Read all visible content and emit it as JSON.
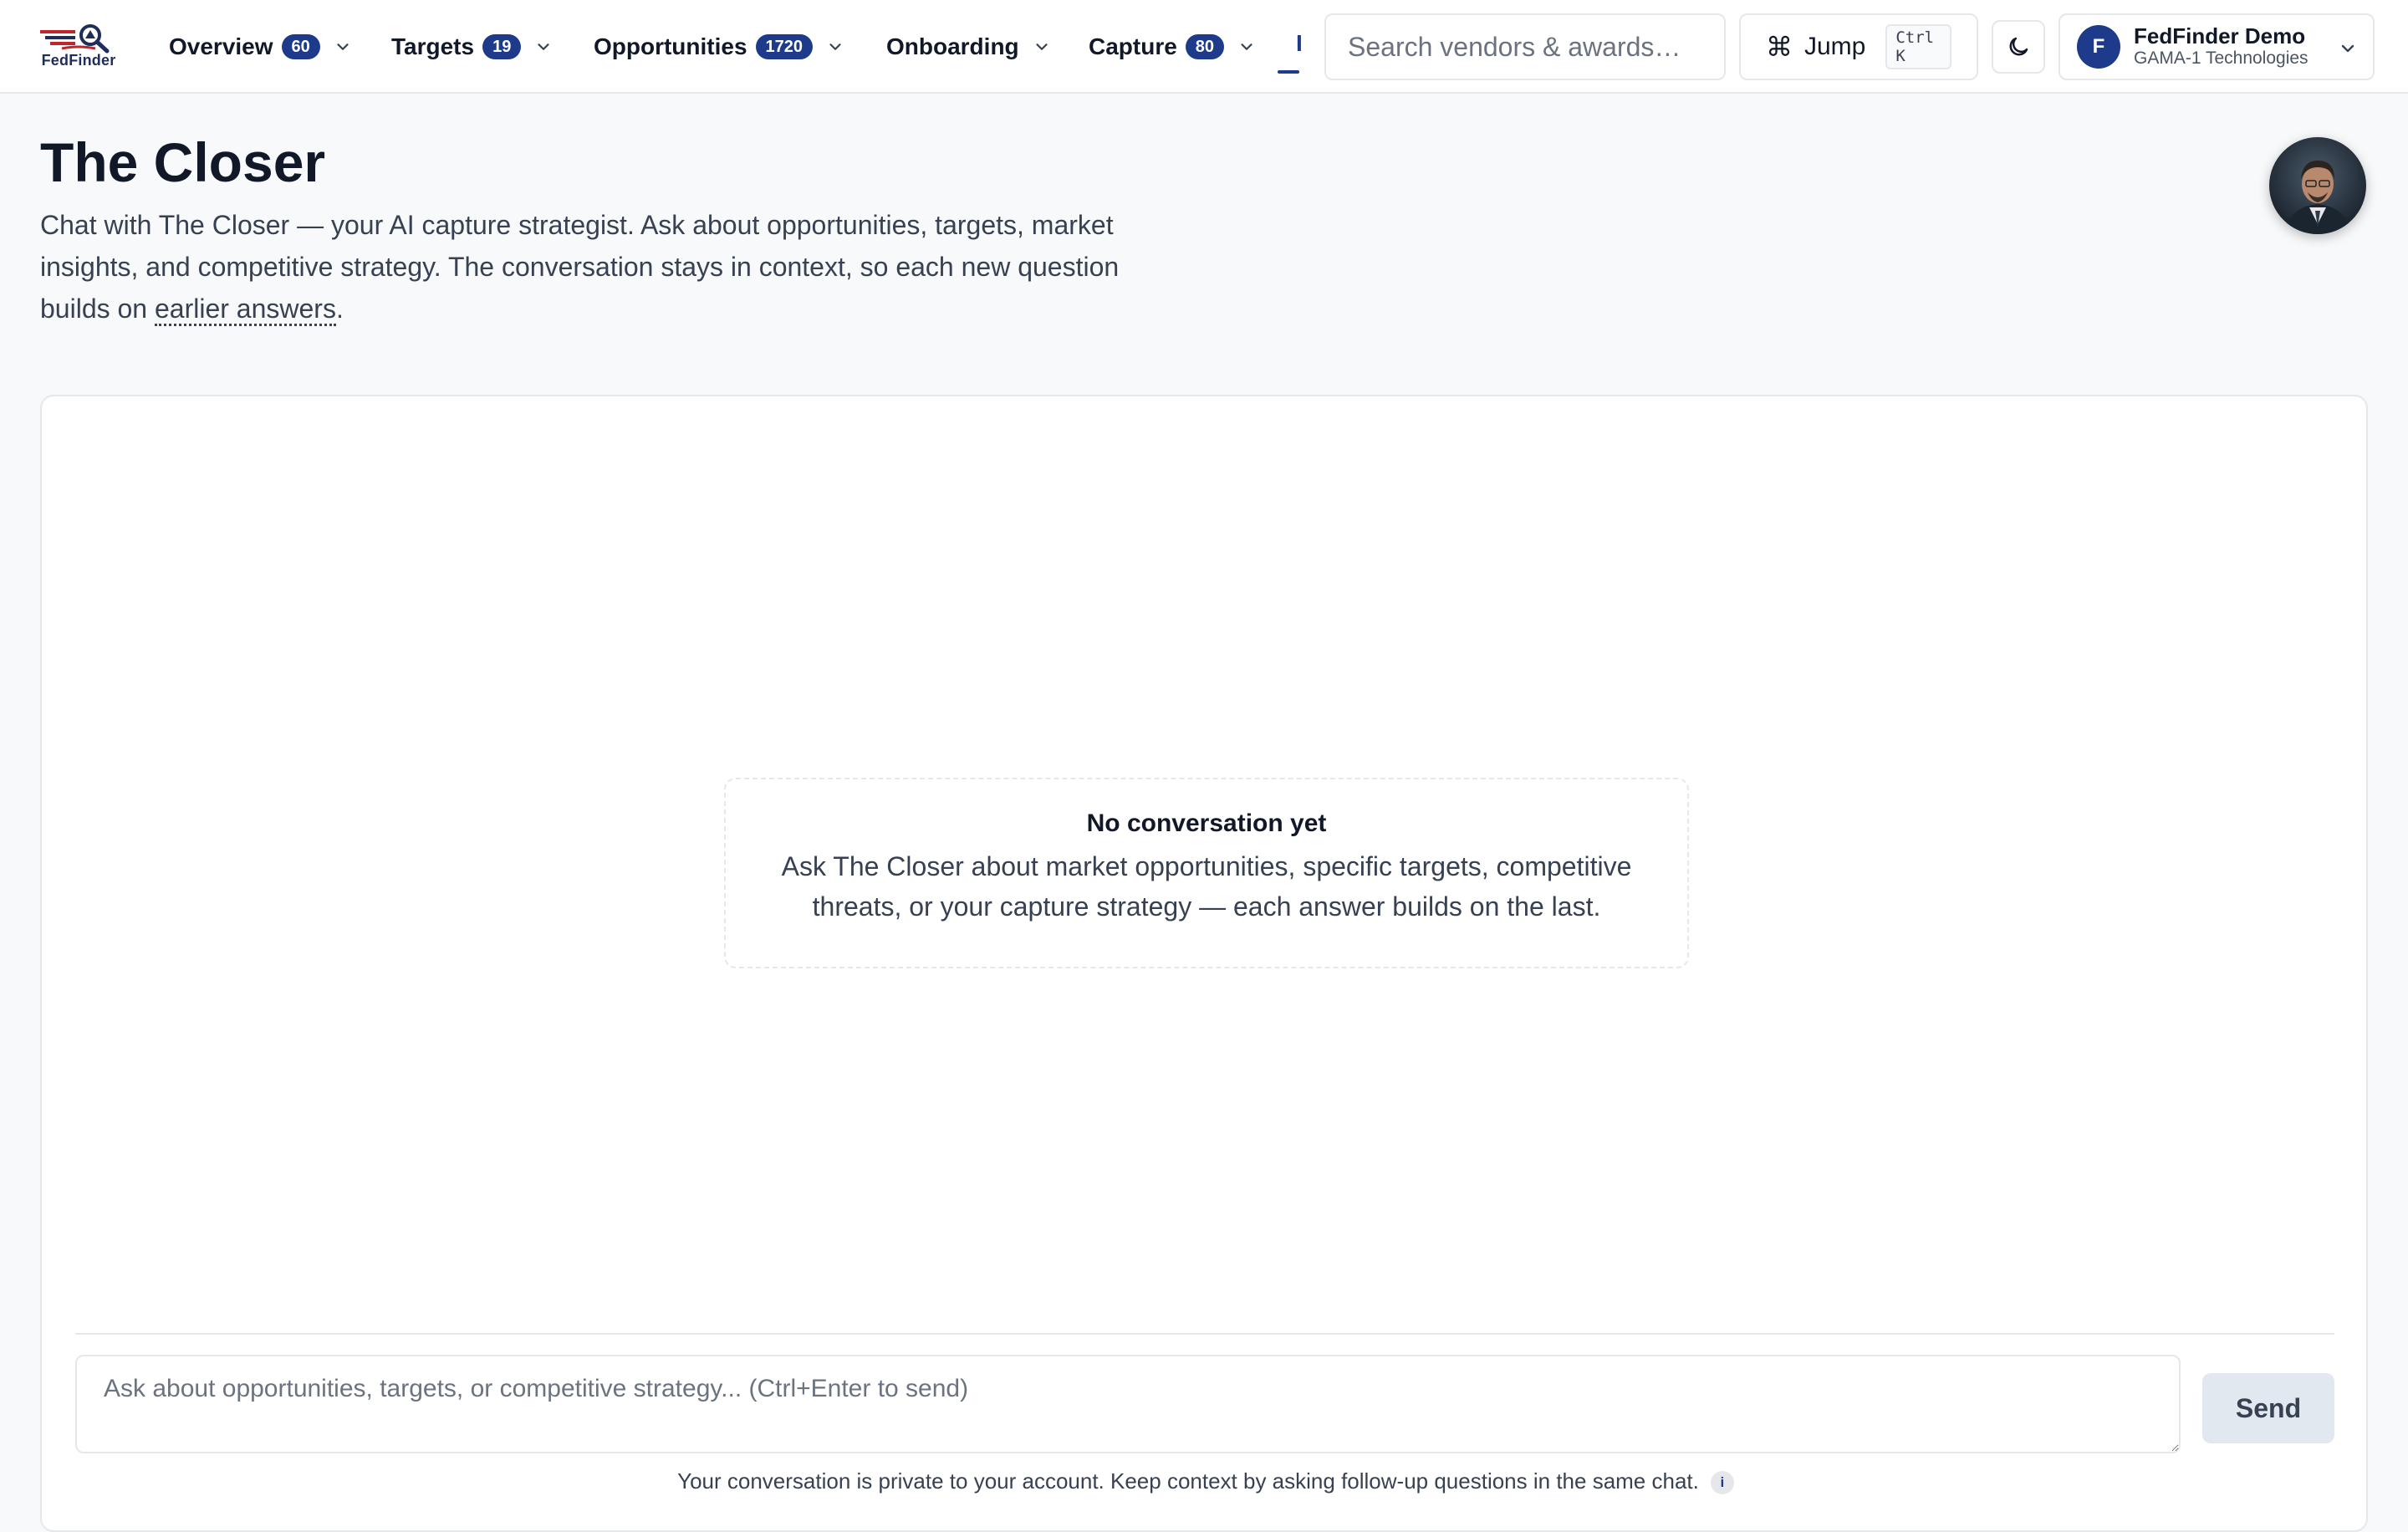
{
  "app": {
    "logo_text": "FedFinder"
  },
  "nav": {
    "items": [
      {
        "label": "Overview",
        "count": "60"
      },
      {
        "label": "Targets",
        "count": "19"
      },
      {
        "label": "Opportunities",
        "count": "1720"
      },
      {
        "label": "Onboarding",
        "count": null
      },
      {
        "label": "Capture",
        "count": "80"
      }
    ],
    "truncated_label": "I"
  },
  "search": {
    "placeholder": "Search vendors & awards…"
  },
  "jump": {
    "symbol": "⌘",
    "label": "Jump",
    "shortcut": "Ctrl K"
  },
  "account": {
    "initial": "F",
    "name": "FedFinder Demo",
    "org": "GAMA-1 Technologies"
  },
  "page": {
    "title": "The Closer",
    "description": "Chat with The Closer — your AI capture strategist. Ask about opportunities, targets, market insights, and competitive strategy. The conversation stays in context, so each new question builds on ",
    "description_link": "earlier answers",
    "description_end": "."
  },
  "chat": {
    "empty_title": "No conversation yet",
    "empty_text": "Ask The Closer about market opportunities, specific targets, competitive threats, or your capture strategy — each answer builds on the last.",
    "input_placeholder": "Ask about opportunities, targets, or competitive strategy... (Ctrl+Enter to send)",
    "send_label": "Send",
    "privacy_note": "Your conversation is private to your account. Keep context by asking follow-up questions in the same chat.",
    "info_glyph": "i"
  },
  "colors": {
    "brand": "#1e3a8a",
    "accent_red": "#c0272d",
    "background": "#f8f9fb"
  }
}
